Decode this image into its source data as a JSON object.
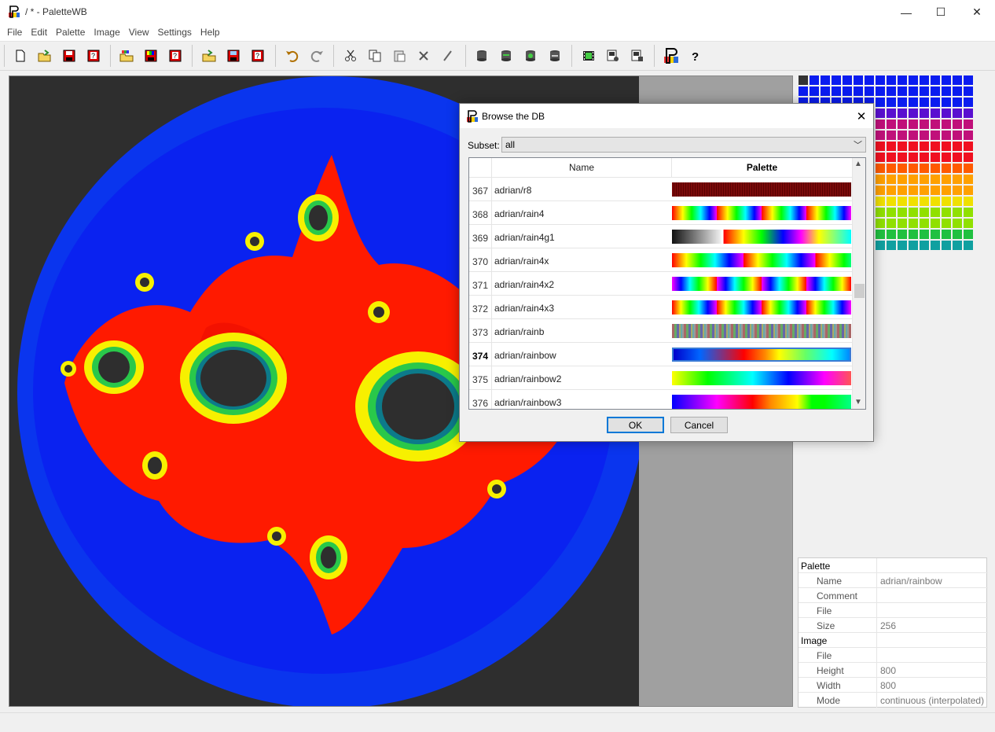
{
  "window": {
    "title": "/ * - PaletteWB",
    "minimize": "—",
    "maximize": "☐",
    "close": "✕"
  },
  "menu": [
    "File",
    "Edit",
    "Palette",
    "Image",
    "View",
    "Settings",
    "Help"
  ],
  "toolbar_icons": [
    "new-icon",
    "open-icon",
    "save-icon",
    "save-as-icon",
    "open-palette-icon",
    "save-palette-icon",
    "save-palette-as-icon",
    "open-image-icon",
    "save-image-icon",
    "save-image-as-icon",
    "undo-icon",
    "redo-icon",
    "cut-icon",
    "copy-icon",
    "paste-icon",
    "delete-icon",
    "edit-icon",
    "db-icon",
    "db-add-icon",
    "db-update-icon",
    "db-remove-icon",
    "film-icon",
    "image-settings-icon",
    "image-info-icon",
    "browse-db-icon",
    "help-icon"
  ],
  "properties": {
    "palette_group": "Palette",
    "name_key": "Name",
    "name_val": "adrian/rainbow",
    "comment_key": "Comment",
    "comment_val": "",
    "file_key": "File",
    "file_val": "",
    "size_key": "Size",
    "size_val": "256",
    "image_group": "Image",
    "ifile_key": "File",
    "ifile_val": "",
    "height_key": "Height",
    "height_val": "800",
    "width_key": "Width",
    "width_val": "800",
    "mode_key": "Mode",
    "mode_val": "continuous (interpolated)"
  },
  "dialog": {
    "title": "Browse the DB",
    "subset_label": "Subset:",
    "subset_value": "all",
    "col_name": "Name",
    "col_palette": "Palette",
    "rows": [
      {
        "num": "367",
        "name": "adrian/r8"
      },
      {
        "num": "368",
        "name": "adrian/rain4"
      },
      {
        "num": "369",
        "name": "adrian/rain4g1"
      },
      {
        "num": "370",
        "name": "adrian/rain4x"
      },
      {
        "num": "371",
        "name": "adrian/rain4x2"
      },
      {
        "num": "372",
        "name": "adrian/rain4x3"
      },
      {
        "num": "373",
        "name": "adrian/rainb"
      },
      {
        "num": "374",
        "name": "adrian/rainbow"
      },
      {
        "num": "375",
        "name": "adrian/rainbow2"
      },
      {
        "num": "376",
        "name": "adrian/rainbow3"
      }
    ],
    "ok": "OK",
    "cancel": "Cancel"
  }
}
